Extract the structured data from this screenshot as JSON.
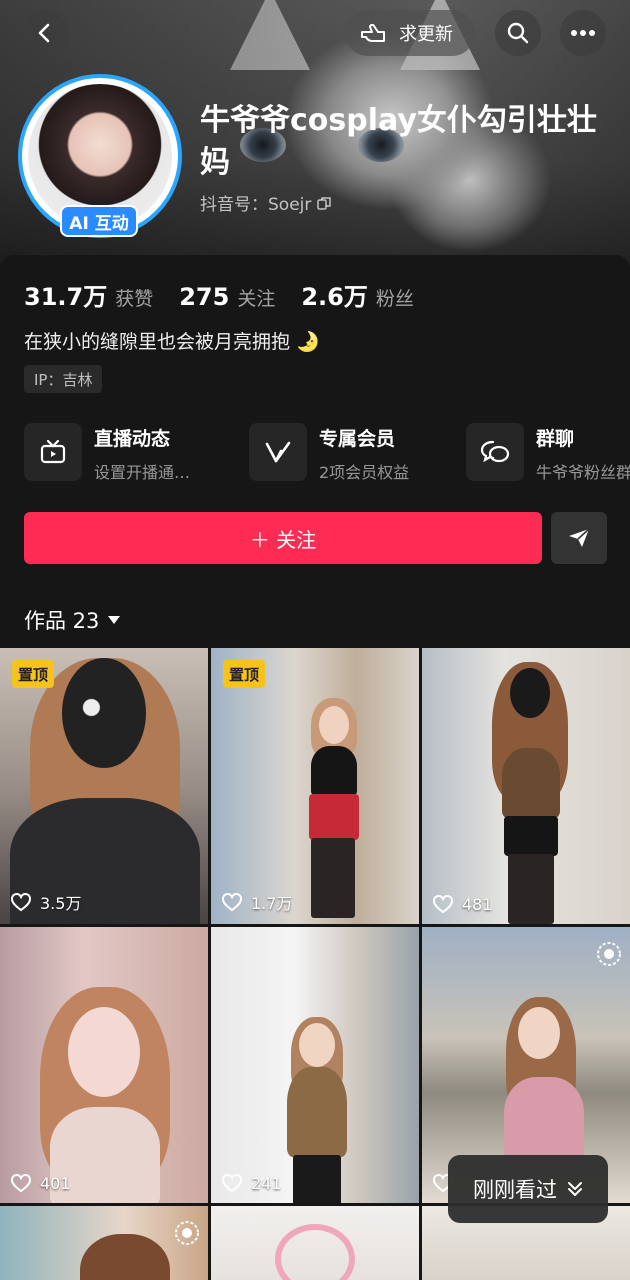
{
  "header": {
    "request_update_label": "求更新",
    "name": "牛爷爷cosplay女仆勾引壮壮妈",
    "douyin_id": "抖音号：Soejr",
    "ai_badge": "AI 互动"
  },
  "stats": [
    {
      "num": "31.7万",
      "label": "获赞"
    },
    {
      "num": "275",
      "label": "关注"
    },
    {
      "num": "2.6万",
      "label": "粉丝"
    }
  ],
  "bio": "在狭小的缝隙里也会被月亮拥抱 🌛",
  "ip": "IP：吉林",
  "features": [
    {
      "title": "直播动态",
      "sub": "设置开播通…"
    },
    {
      "title": "专属会员",
      "sub": "2项会员权益"
    },
    {
      "title": "群聊",
      "sub": "牛爷爷粉丝群"
    }
  ],
  "follow_label": "＋ 关注",
  "works_label": "作品 23",
  "pin_label": "置顶",
  "videos": [
    {
      "likes": "3.5万",
      "pinned": true
    },
    {
      "likes": "1.7万",
      "pinned": true
    },
    {
      "likes": "481",
      "pinned": false
    },
    {
      "likes": "401",
      "pinned": false
    },
    {
      "likes": "241",
      "pinned": false
    },
    {
      "likes": "",
      "pinned": false
    }
  ],
  "recent_label": "刚刚看过"
}
